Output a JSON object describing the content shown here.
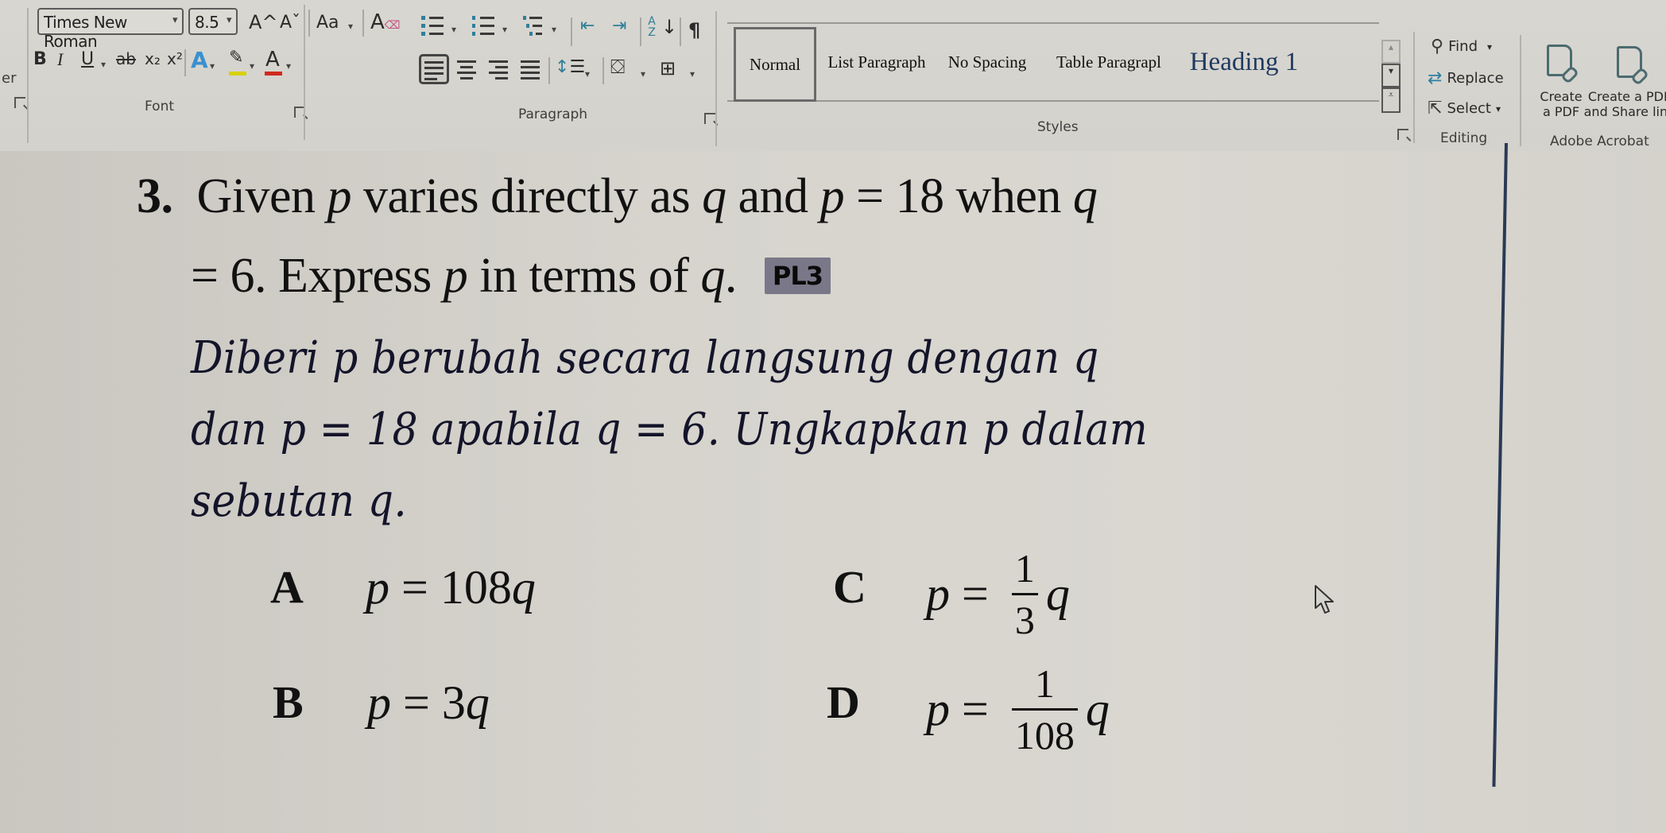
{
  "ribbon": {
    "font_group": {
      "label": "Font",
      "font_name": "Times New Roman",
      "font_size": "8.5",
      "grow_font": "A^",
      "shrink_font": "Aˇ",
      "change_case": "Aa",
      "clear_formatting_icon": "clear-formatting-icon",
      "bold": "B",
      "italic": "I",
      "underline": "U",
      "strikethrough": "ab",
      "subscript": "x₂",
      "superscript": "x²",
      "text_effects": "A",
      "highlight_color": "#d8d000",
      "font_color": "#d02a20",
      "font_color_label": "A",
      "left_cut_label": "er"
    },
    "paragraph_group": {
      "label": "Paragraph",
      "show_marks": "¶",
      "sort_label": "A Z"
    },
    "styles_group": {
      "label": "Styles",
      "items": [
        {
          "label": "Normal",
          "selected": true
        },
        {
          "label": "List Paragraph",
          "selected": false
        },
        {
          "label": "No Spacing",
          "selected": false
        },
        {
          "label": "Table Paragrapl",
          "selected": false
        },
        {
          "label": "Heading 1",
          "selected": false
        }
      ]
    },
    "editing_group": {
      "label": "Editing",
      "find": "Find",
      "replace": "Replace",
      "select": "Select"
    },
    "acrobat_group": {
      "label": "Adobe Acrobat",
      "create_pdf_line1": "Create",
      "create_pdf_line2": "a PDF",
      "create_share_line1": "Create a PDF",
      "create_share_line2": "and Share link"
    }
  },
  "document": {
    "question": {
      "number": "3.",
      "line1_a": "Given ",
      "var_p": "p",
      "line1_b": " varies directly as ",
      "var_q": "q",
      "line1_c": " and ",
      "line1_d": " = 18 when ",
      "line2_a": "= 6. Express ",
      "line2_b": " in terms of ",
      "line2_c": ".",
      "badge": "PL3"
    },
    "malay": {
      "line1": "Diberi p berubah secara langsung dengan q",
      "line2": "dan p = 18 apabila q = 6. Ungkapkan p dalam",
      "line3": "sebutan q."
    },
    "options": [
      {
        "letter": "A",
        "lhs": "p",
        "eq": " = ",
        "coef": "108",
        "var": "q"
      },
      {
        "letter": "B",
        "lhs": "p",
        "eq": " = ",
        "coef": "3",
        "var": "q"
      },
      {
        "letter": "C",
        "lhs": "p",
        "eq": " = ",
        "num": "1",
        "den": "3",
        "var": "q"
      },
      {
        "letter": "D",
        "lhs": "p",
        "eq": " = ",
        "num": "1",
        "den": "108",
        "var": "q"
      }
    ]
  }
}
